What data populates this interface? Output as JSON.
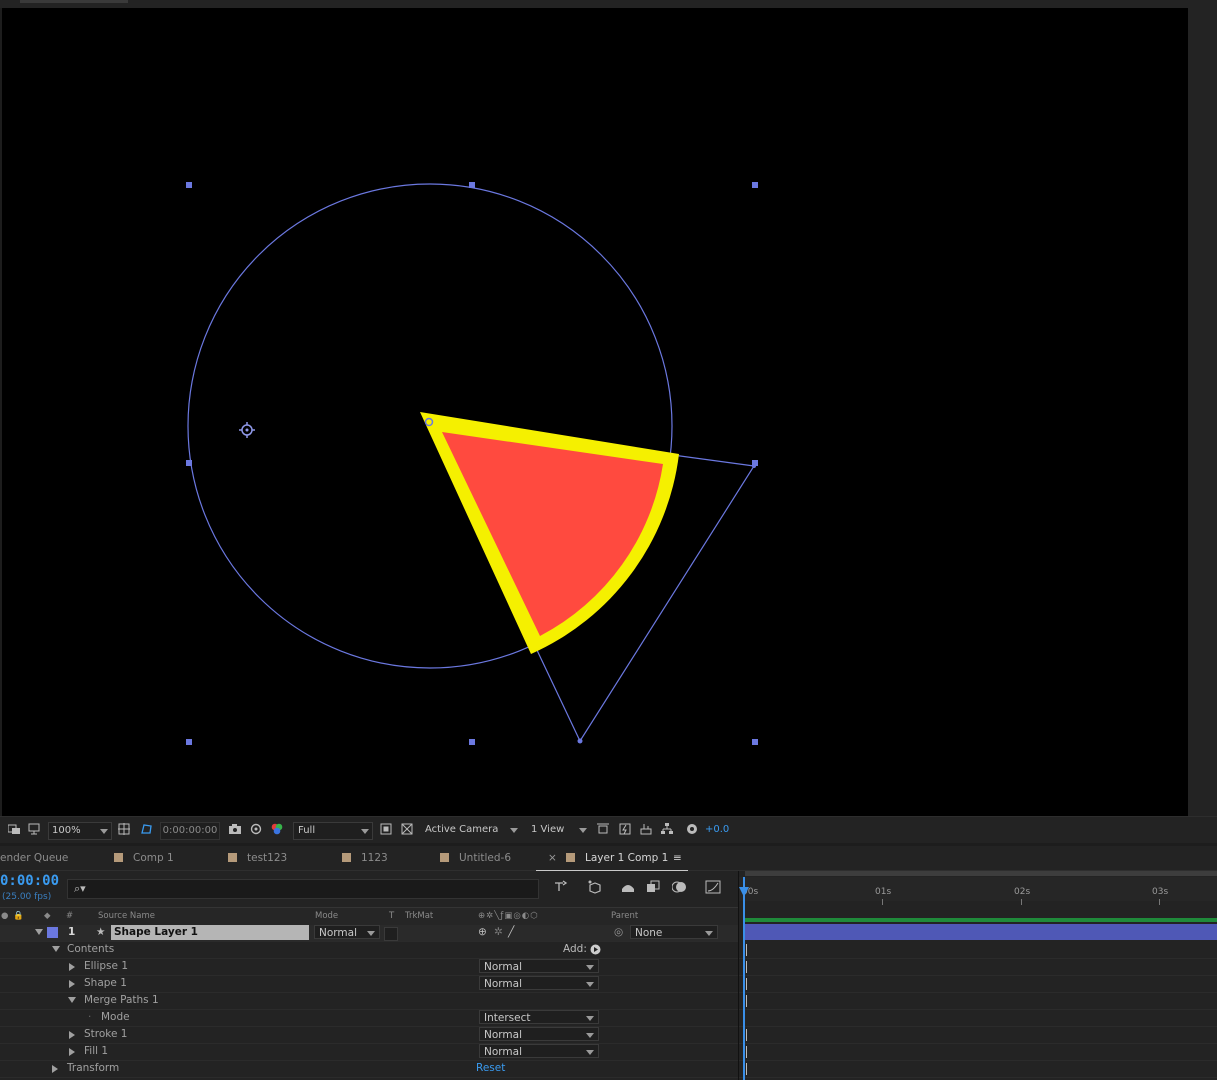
{
  "viewer_toolbar": {
    "zoom": "100%",
    "timecode": "0:00:00:00",
    "resolution": "Full",
    "camera": "Active Camera",
    "views": "1 View",
    "exposure": "+0.0"
  },
  "tabs": [
    {
      "label": "ender Queue",
      "swatch": ""
    },
    {
      "label": "Comp 1",
      "swatch": "#b59a7a"
    },
    {
      "label": "test123",
      "swatch": "#b59a7a"
    },
    {
      "label": "1123",
      "swatch": "#b59a7a"
    },
    {
      "label": "Untitled-6",
      "swatch": "#b59a7a"
    },
    {
      "label": "Layer 1 Comp 1",
      "swatch": "#b59a7a",
      "active": true
    }
  ],
  "active_tab_close": "×",
  "active_tab_menu": "≡",
  "timeline": {
    "timecode": "0:00:00",
    "fps": "(25.00 fps)",
    "columns": {
      "num": "#",
      "source_name": "Source Name",
      "mode": "Mode",
      "t": "T",
      "trkmat": "TrkMat",
      "parent": "Parent"
    },
    "layer": {
      "number": "1",
      "name": "Shape Layer 1",
      "mode": "Normal",
      "parent": "None",
      "label_color": "#6b78e0"
    },
    "add_label": "Add:",
    "rows": [
      {
        "name": "Contents",
        "indent": 1,
        "open": true,
        "mode": ""
      },
      {
        "name": "Ellipse 1",
        "indent": 2,
        "open": false,
        "mode": "Normal"
      },
      {
        "name": "Shape 1",
        "indent": 2,
        "open": false,
        "mode": "Normal"
      },
      {
        "name": "Merge Paths 1",
        "indent": 2,
        "open": true,
        "mode": ""
      },
      {
        "name": "Mode",
        "indent": 3,
        "open": null,
        "mode": "Intersect"
      },
      {
        "name": "Stroke 1",
        "indent": 2,
        "open": false,
        "mode": "Normal"
      },
      {
        "name": "Fill 1",
        "indent": 2,
        "open": false,
        "mode": "Normal"
      },
      {
        "name": "Transform",
        "indent": 1,
        "open": false,
        "mode": ""
      }
    ],
    "reset_label": "Reset",
    "ruler": [
      "00s",
      "01s",
      "02s",
      "03s"
    ]
  },
  "colors": {
    "fill": "#ff4a3f",
    "stroke": "#f5f000",
    "path_outline": "#6b78e0",
    "accent": "#3a9bf0"
  }
}
